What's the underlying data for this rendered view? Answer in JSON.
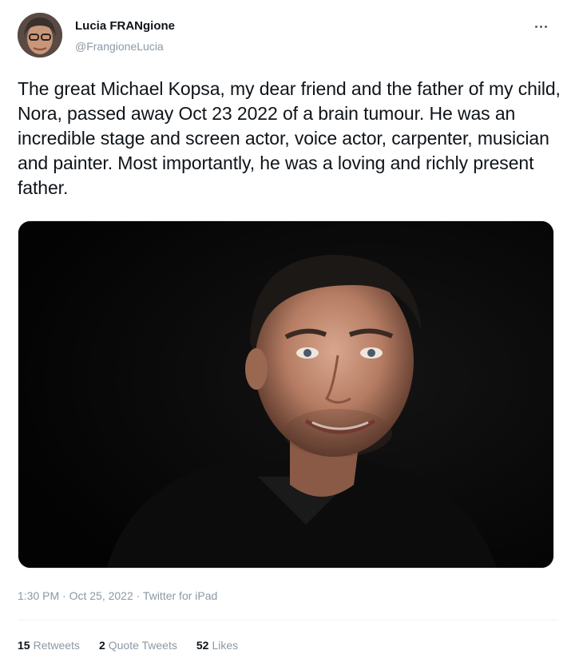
{
  "author": {
    "display_name": "Lucia FRANgione",
    "handle": "@FrangioneLucia",
    "avatar_icon": "profile-photo"
  },
  "more_icon": "more-horizontal-icon",
  "tweet": {
    "text": "The great Michael Kopsa, my dear friend and the father of my child, Nora, passed away Oct 23 2022 of a brain tumour. He was an incredible stage and screen actor, voice actor, carpenter, musician and painter. Most importantly, he was a loving and richly present father.",
    "timestamp": "1:30 PM · Oct 25, 2022 · Twitter for iPad"
  },
  "stats": {
    "retweets_count": "15",
    "retweets_label": "Retweets",
    "quotes_count": "2",
    "quotes_label": "Quote Tweets",
    "likes_count": "52",
    "likes_label": "Likes"
  },
  "colors": {
    "text": "#0f1419",
    "secondary": "#8b98a5",
    "photo_background": "#070707"
  }
}
